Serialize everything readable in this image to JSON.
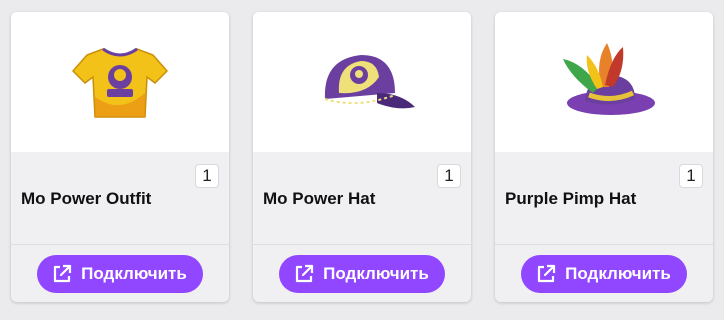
{
  "items": [
    {
      "name": "Mo Power Outfit",
      "quantity": "1",
      "button_label": "Подключить",
      "image_icon": "tshirt-icon"
    },
    {
      "name": "Mo Power Hat",
      "quantity": "1",
      "button_label": "Подключить",
      "image_icon": "cap-icon"
    },
    {
      "name": "Purple Pimp Hat",
      "quantity": "1",
      "button_label": "Подключить",
      "image_icon": "feather-hat-icon"
    }
  ],
  "colors": {
    "accent": "#9147ff",
    "page_bg": "#ebebed",
    "card_bg": "#f0f0f3",
    "card_image_bg": "#ffffff"
  },
  "icons": {
    "button_icon": "external-link-icon"
  }
}
